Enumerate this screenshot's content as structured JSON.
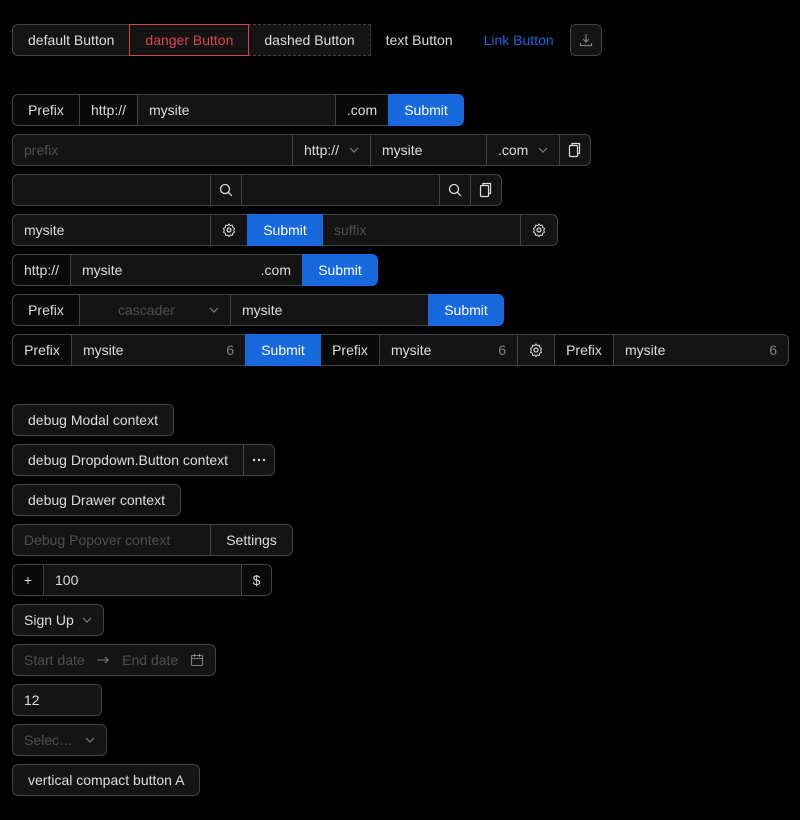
{
  "buttons": {
    "default": "default Button",
    "danger": "danger Button",
    "dashed": "dashed Button",
    "text": "text Button",
    "link": "Link Button"
  },
  "row2": {
    "prefix": "Prefix",
    "protocol": "http://",
    "value": "mysite",
    "suffix": ".com",
    "submit": "Submit"
  },
  "row3": {
    "placeholder": "prefix",
    "protocol": "http://",
    "value": "mysite",
    "suffix": ".com"
  },
  "row5": {
    "value": "mysite",
    "submit": "Submit",
    "placeholder": "suffix"
  },
  "row6": {
    "protocol": "http://",
    "value": "mysite",
    "suffix": ".com",
    "submit": "Submit"
  },
  "row7": {
    "prefix": "Prefix",
    "cascader_placeholder": "cascader",
    "value": "mysite",
    "submit": "Submit"
  },
  "row8": {
    "prefix1": "Prefix",
    "value1": "mysite",
    "count1": "6",
    "submit": "Submit",
    "prefix2": "Prefix",
    "value2": "mysite",
    "count2": "6",
    "prefix3": "Prefix",
    "value3": "mysite",
    "count3": "6"
  },
  "debug": {
    "modal": "debug Modal context",
    "dropdown": "debug Dropdown.Button context",
    "drawer": "debug Drawer context",
    "popover_placeholder": "Debug Popover context",
    "settings": "Settings"
  },
  "number": {
    "plus": "+",
    "value": "100",
    "currency": "$"
  },
  "signup": "Sign Up",
  "daterange": {
    "start": "Start date",
    "end": "End date"
  },
  "plain_number": "12",
  "select_placeholder": "Selec…",
  "vertical_button": "vertical compact button A",
  "icons": [
    "download-icon",
    "search-icon",
    "copy-icon",
    "setting-icon",
    "chevron-down-icon",
    "calendar-icon",
    "ellipsis-icon",
    "arrow-right-icon"
  ]
}
